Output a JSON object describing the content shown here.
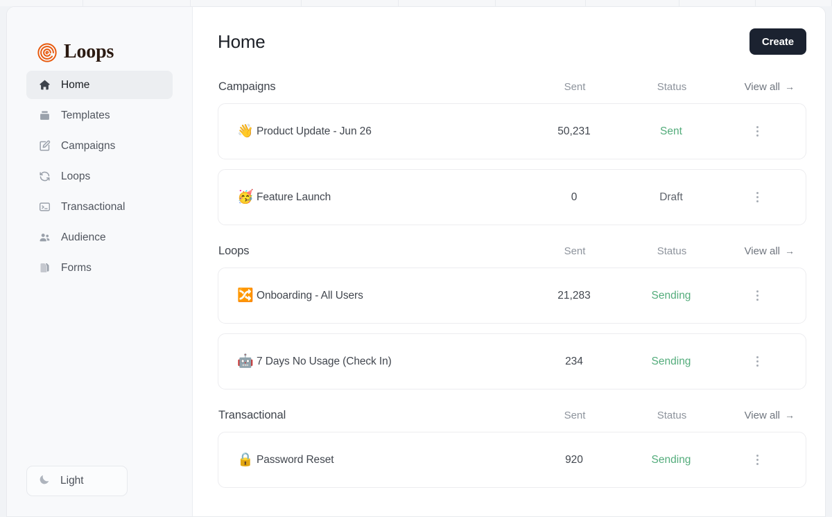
{
  "window": {
    "chrome_tab_count": 9
  },
  "sidebar": {
    "brand": {
      "name": "Loops",
      "logo_icon": "loops-spiral-logo",
      "logo_color": "#e8590c"
    },
    "items": [
      {
        "label": "Home",
        "icon": "home-icon",
        "active": true
      },
      {
        "label": "Templates",
        "icon": "templates-icon",
        "active": false
      },
      {
        "label": "Campaigns",
        "icon": "edit-square-icon",
        "active": false
      },
      {
        "label": "Loops",
        "icon": "refresh-icon",
        "active": false
      },
      {
        "label": "Transactional",
        "icon": "terminal-icon",
        "active": false
      },
      {
        "label": "Audience",
        "icon": "people-icon",
        "active": false
      },
      {
        "label": "Forms",
        "icon": "forms-icon",
        "active": false
      }
    ],
    "theme_toggle": {
      "label": "Light",
      "icon": "moon-icon"
    }
  },
  "header": {
    "title": "Home",
    "create_label": "Create"
  },
  "columns": {
    "sent": "Sent",
    "status": "Status",
    "view_all": "View all",
    "view_all_arrow": "→"
  },
  "sections": [
    {
      "title": "Campaigns",
      "rows": [
        {
          "emoji": "👋",
          "emoji_name": "waving-hand-emoji",
          "name": "Product Update - Jun 26",
          "sent": "50,231",
          "status": "Sent",
          "status_color": "green"
        },
        {
          "emoji": "🥳",
          "emoji_name": "partying-face-emoji",
          "name": "Feature Launch",
          "sent": "0",
          "status": "Draft",
          "status_color": "gray"
        }
      ]
    },
    {
      "title": "Loops",
      "rows": [
        {
          "emoji": "🔀",
          "emoji_name": "shuffle-tracks-emoji",
          "name": "Onboarding - All Users",
          "sent": "21,283",
          "status": "Sending",
          "status_color": "green"
        },
        {
          "emoji": "🤖",
          "emoji_name": "robot-emoji",
          "name": "7 Days No Usage (Check In)",
          "sent": "234",
          "status": "Sending",
          "status_color": "green"
        }
      ]
    },
    {
      "title": "Transactional",
      "rows": [
        {
          "emoji": "🔒",
          "emoji_name": "lock-emoji",
          "name": "Password Reset",
          "sent": "920",
          "status": "Sending",
          "status_color": "green"
        }
      ]
    }
  ],
  "colors": {
    "brand_orange": "#e8590c",
    "status_green": "#53ac7b",
    "create_button_bg": "#1b2230",
    "sidebar_bg": "#f8f9fb"
  }
}
